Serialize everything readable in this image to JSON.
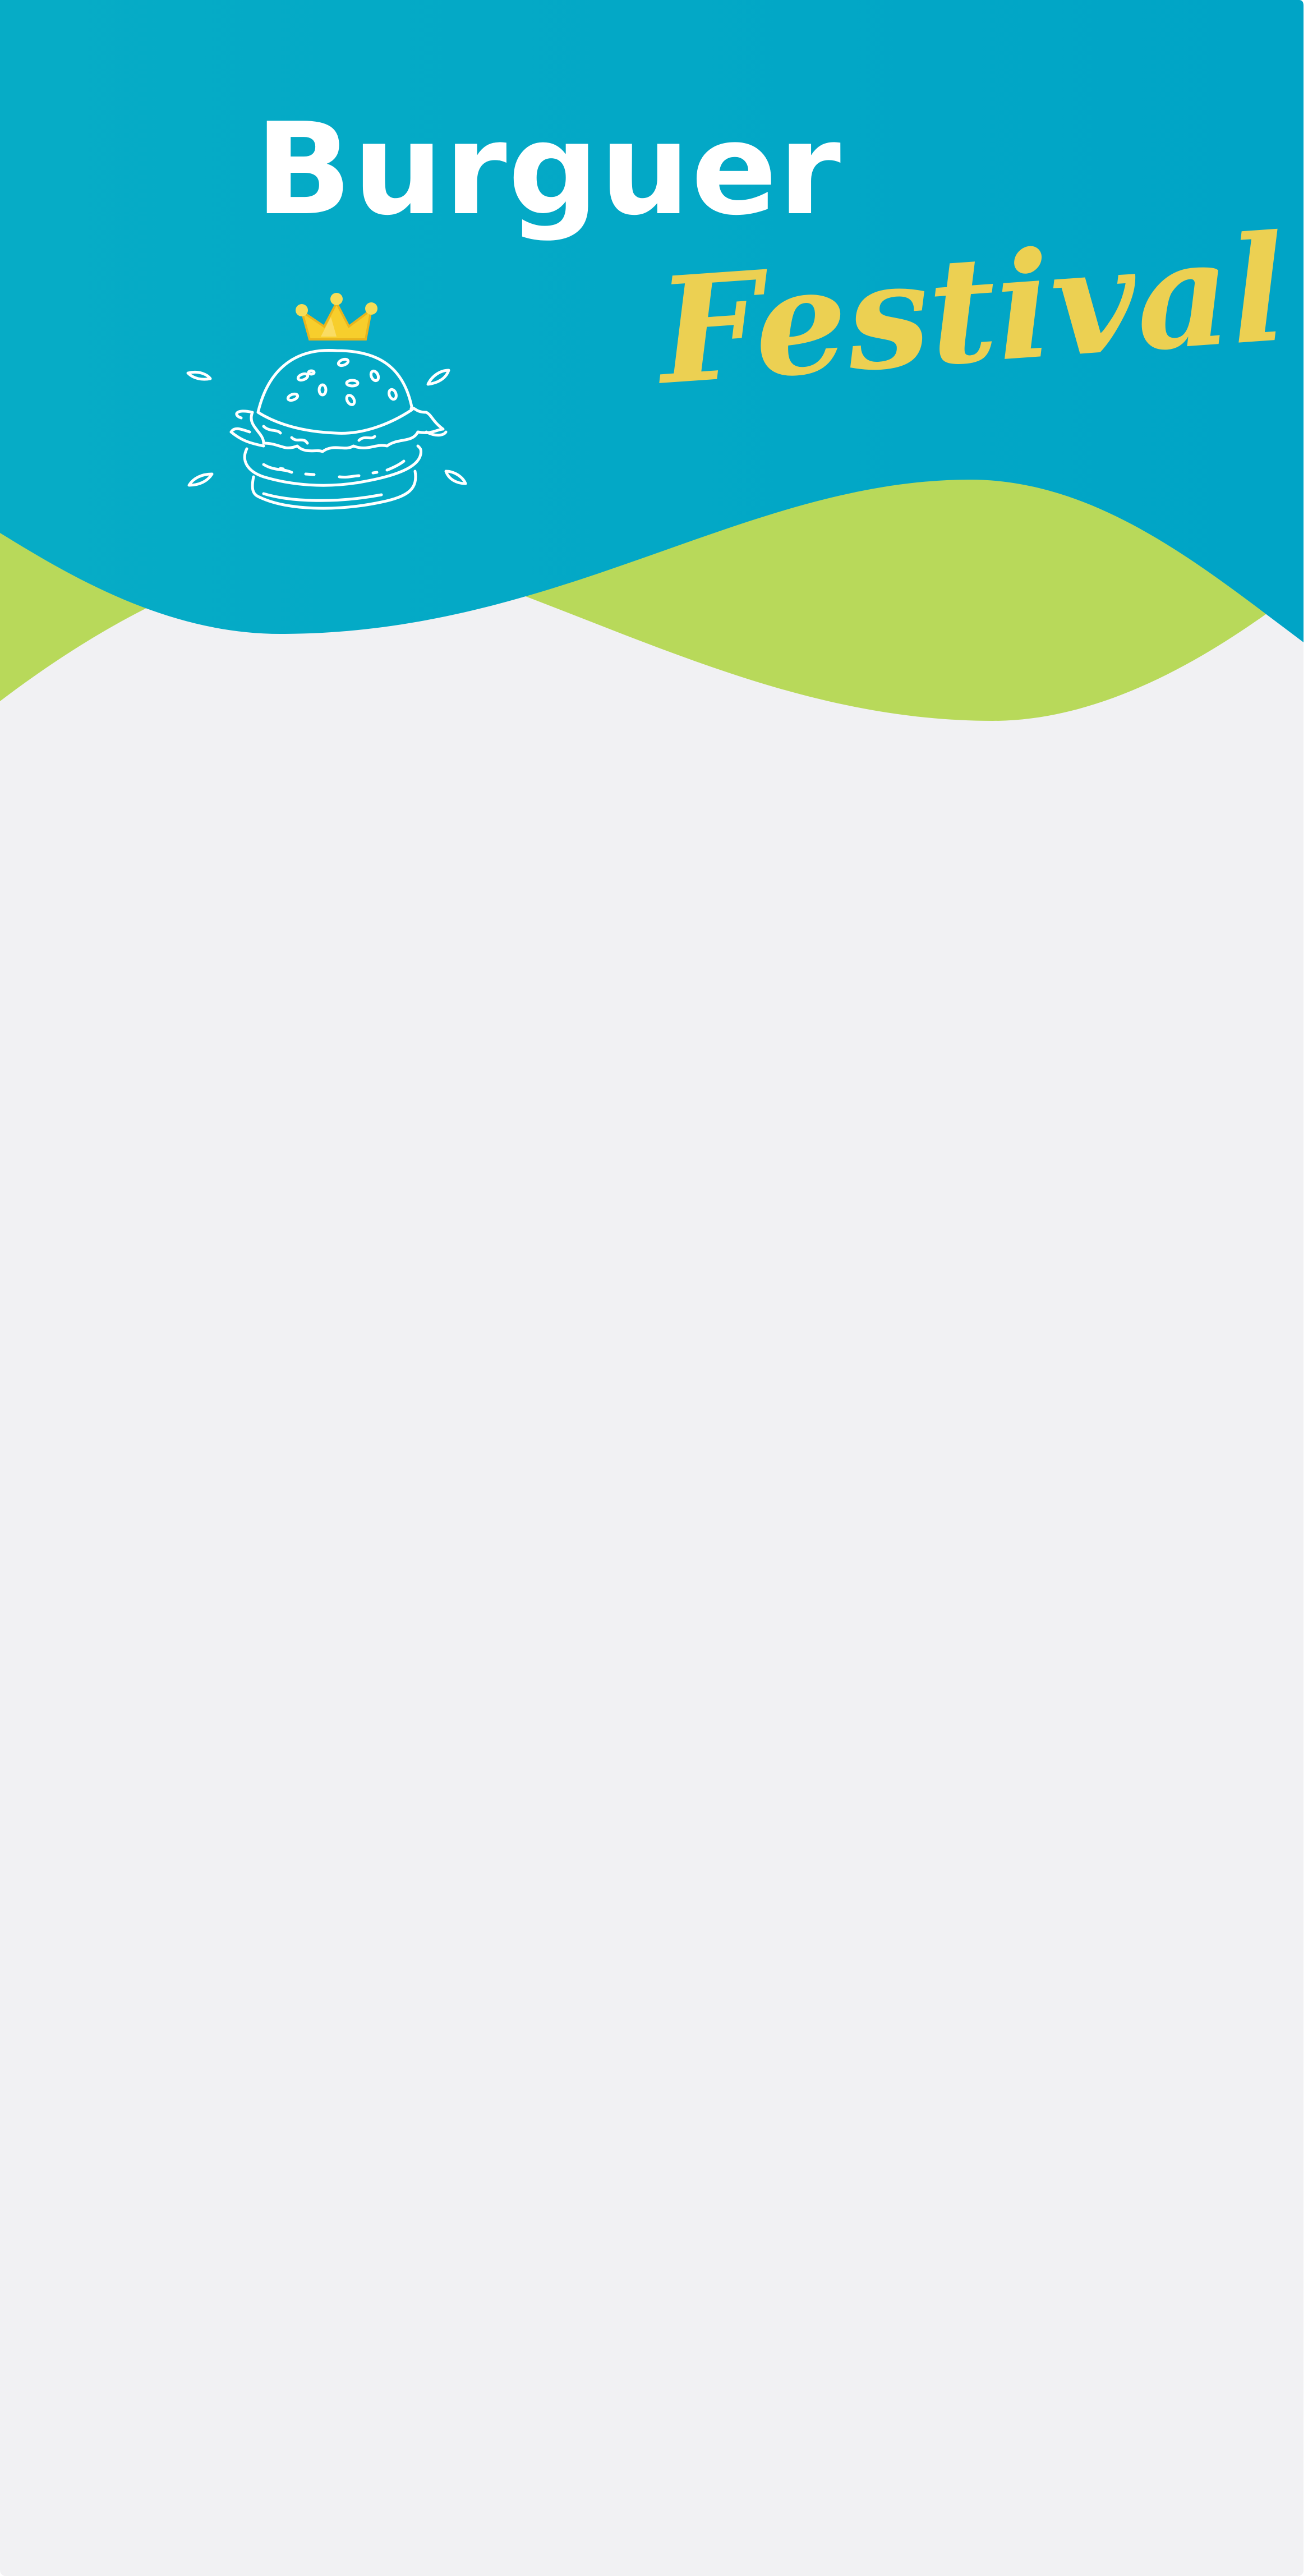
{
  "poster": {
    "title": "Burguer",
    "subtitle": "Festival"
  },
  "icons": {
    "crown": "crown-icon",
    "burger": "burger-icon"
  },
  "colors": {
    "header_blue": "#00a4c6",
    "header_blue_left": "#06acc6",
    "wave_green": "#b8d95a",
    "background": "#f1f1f3",
    "title_white": "#ffffff",
    "festival_yellow": "#ecd052",
    "crown_yellow": "#f7ce2c",
    "crown_gem": "#f6dd58"
  }
}
